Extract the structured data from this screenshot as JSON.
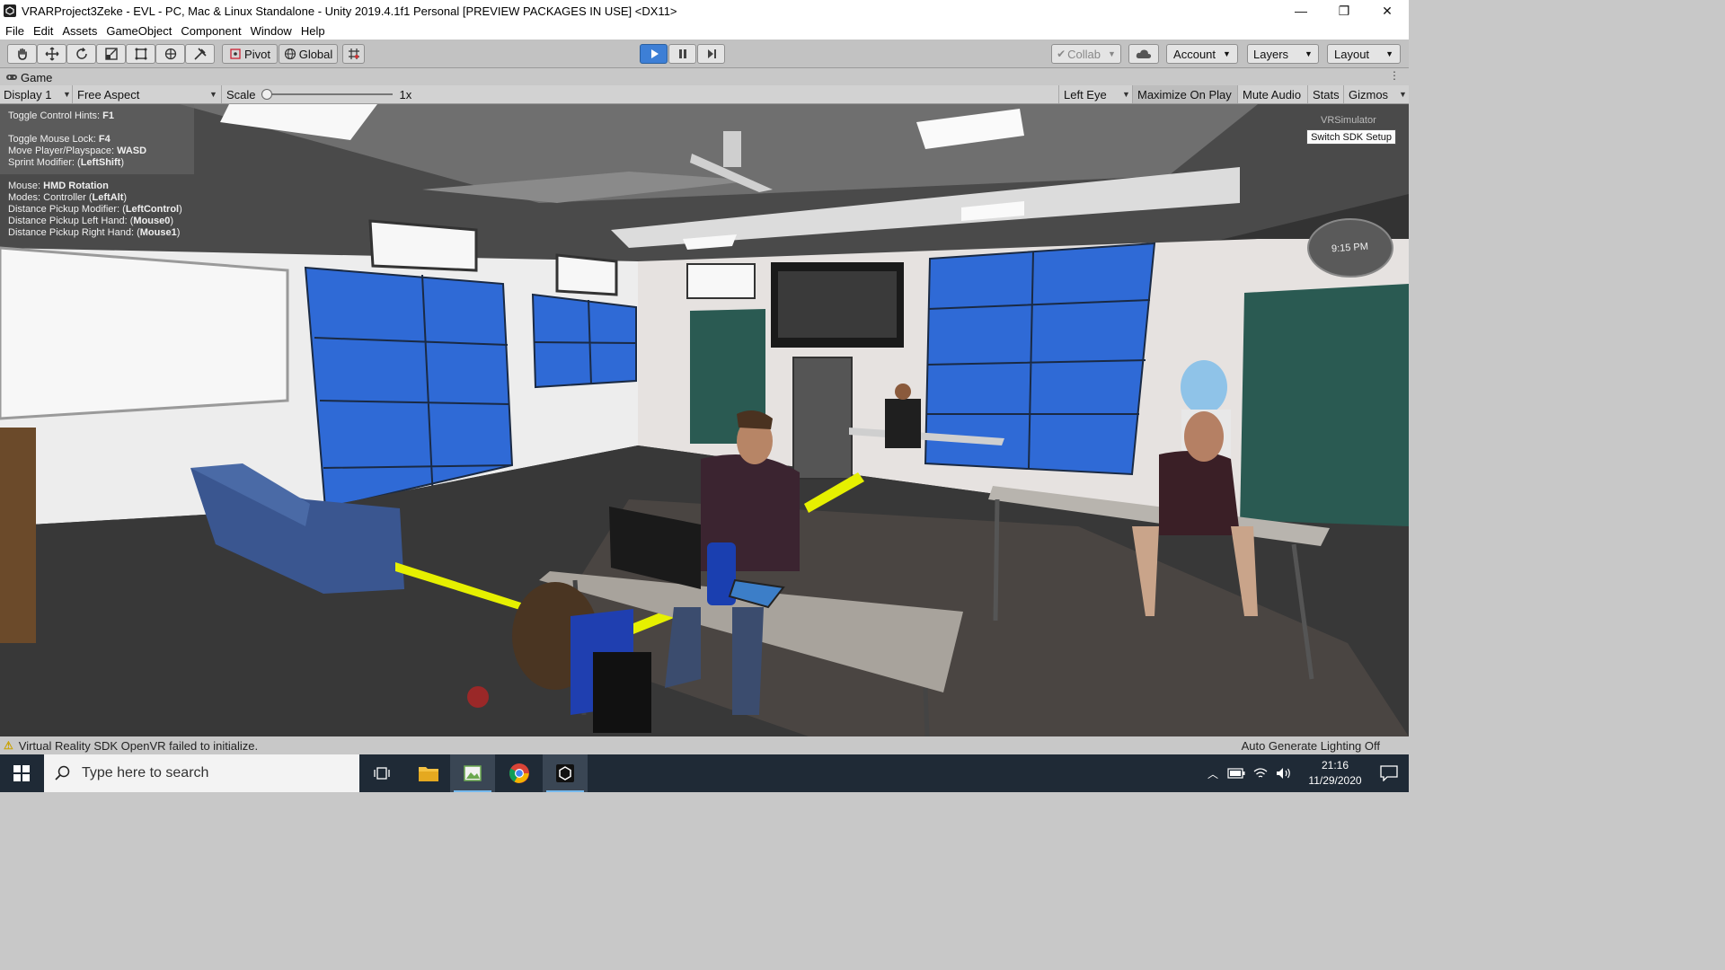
{
  "window": {
    "title": "VRARProject3Zeke - EVL - PC, Mac & Linux Standalone - Unity 2019.4.1f1 Personal [PREVIEW PACKAGES IN USE] <DX11>",
    "minimize": "—",
    "maximize": "❐",
    "close": "✕"
  },
  "menu": [
    "File",
    "Edit",
    "Assets",
    "GameObject",
    "Component",
    "Window",
    "Help"
  ],
  "toolbar": {
    "pivot_label": "Pivot",
    "global_label": "Global",
    "collab_label": "Collab",
    "account_label": "Account",
    "layers_label": "Layers",
    "layout_label": "Layout",
    "play_state": "playing"
  },
  "game_tab": {
    "label": "Game"
  },
  "game_bar": {
    "display": "Display 1",
    "aspect": "Free Aspect",
    "scale_label": "Scale",
    "scale_value": "1x",
    "scale_level": 0,
    "eye": "Left Eye",
    "maximize_on_play": "Maximize On Play",
    "mute_audio": "Mute Audio",
    "stats": "Stats",
    "gizmos": "Gizmos"
  },
  "overlay": {
    "hints": [
      {
        "pre": "Toggle Control Hints: ",
        "bold": "F1"
      },
      {
        "pre": "Toggle Mouse Lock: ",
        "bold": "F4"
      },
      {
        "pre": "Move Player/Playspace: ",
        "bold": "WASD"
      },
      {
        "pre": "Sprint Modifier: (",
        "bold": "LeftShift",
        "post": ")"
      },
      {
        "pre": "Mouse: ",
        "bold": "HMD Rotation"
      },
      {
        "pre": "Modes: Controller (",
        "bold": "LeftAlt",
        "post": ")"
      },
      {
        "pre": "Distance Pickup Modifier: (",
        "bold": "LeftControl",
        "post": ")"
      },
      {
        "pre": "Distance Pickup Left Hand: (",
        "bold": "Mouse0",
        "post": ")"
      },
      {
        "pre": "Distance Pickup Right Hand: (",
        "bold": "Mouse1",
        "post": ")"
      }
    ],
    "sdk_label": "VRSimulator",
    "switch_sdk": "Switch SDK Setup",
    "wall_clock": "9:15 PM"
  },
  "status": {
    "message": "Virtual Reality SDK OpenVR failed to initialize.",
    "lighting": "Auto Generate Lighting Off"
  },
  "taskbar": {
    "search_placeholder": "Type here to search",
    "time": "21:16",
    "date": "11/29/2020"
  },
  "colors": {
    "unity_toolbar": "#c2c2c2",
    "play_active": "#3d7fd6",
    "taskbar": "#1f2a36",
    "screen_blue": "#2f6ad6",
    "floor_yellow": "#e6f000"
  }
}
